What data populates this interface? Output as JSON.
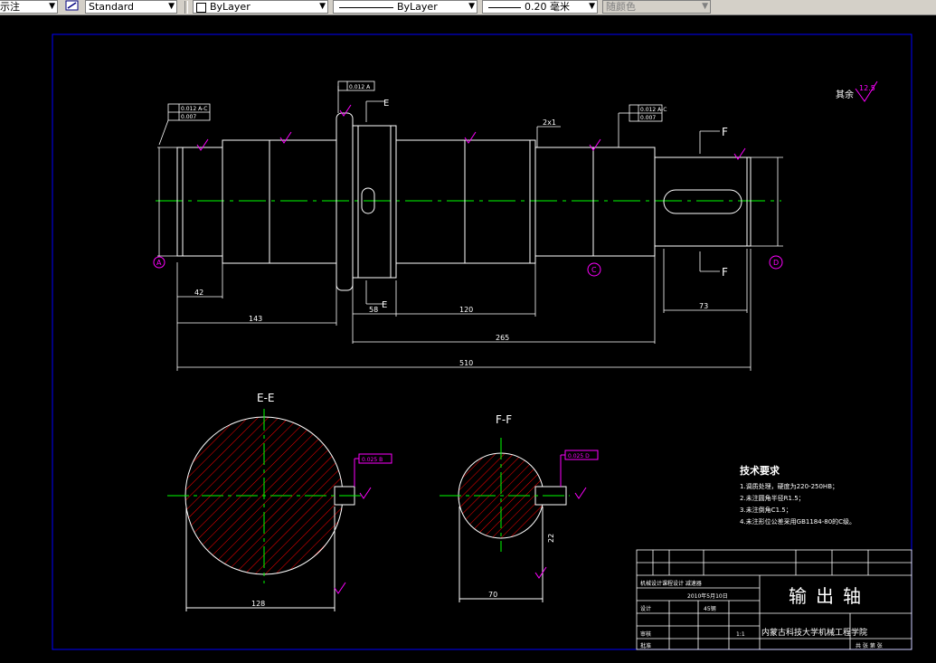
{
  "toolbar": {
    "textstyle_label": "示注",
    "dimstyle_value": "Standard",
    "layer_value": "ByLayer",
    "linetype_value": "ByLayer",
    "lineweight_value": "0.20 毫米",
    "plotstyle_value": "随颜色"
  },
  "colors": {
    "background": "#000000",
    "outline": "#ffffff",
    "centerline": "#00ff00",
    "annotation": "#ff00ff",
    "frame": "#0000ff",
    "hatch": "#ff0000"
  },
  "drawing": {
    "roughness_note": "其余",
    "roughness_value": "12.5",
    "section_e_label": "E",
    "section_f_label": "F",
    "section_ee_title": "E-E",
    "section_ff_title": "F-F",
    "chamfer_note": "2x1",
    "tolerance_left_1": "0.012 A-C",
    "tolerance_left_2": "0.007",
    "tolerance_top": "0.012 A",
    "tolerance_right_1": "0.012 A-C",
    "tolerance_right_2": "0.007",
    "datum_a": "A",
    "datum_b": "B",
    "datum_c": "C",
    "datum_d": "D",
    "dim_42": "42",
    "dim_143": "143",
    "dim_58": "58",
    "dim_120": "120",
    "dim_265": "265",
    "dim_510": "510",
    "dim_73": "73",
    "dim_ee_width": "128",
    "dim_ff_width": "70",
    "dim_ff_depth": "22",
    "tolerance_ee": "0.025 B",
    "tolerance_ff": "0.025 D"
  },
  "tech_requirements": {
    "title": "技术要求",
    "items": [
      "1.调质处理，硬度为220-250HB；",
      "2.未注圆角半径R1.5；",
      "3.未注倒角C1.5；",
      "4.未注形位公差采用GB1184-80的C级。"
    ]
  },
  "title_block": {
    "part_name": "输出轴",
    "school": "内蒙古科技大学机械工程学院",
    "project": "机械设计课程设计 减速器",
    "date": "2010年5月10日",
    "material": "45钢",
    "scale": "1:1",
    "design_label": "设计",
    "check_label": "审核",
    "approve_label": "批准",
    "sheet_label": "共 张 第 张"
  }
}
